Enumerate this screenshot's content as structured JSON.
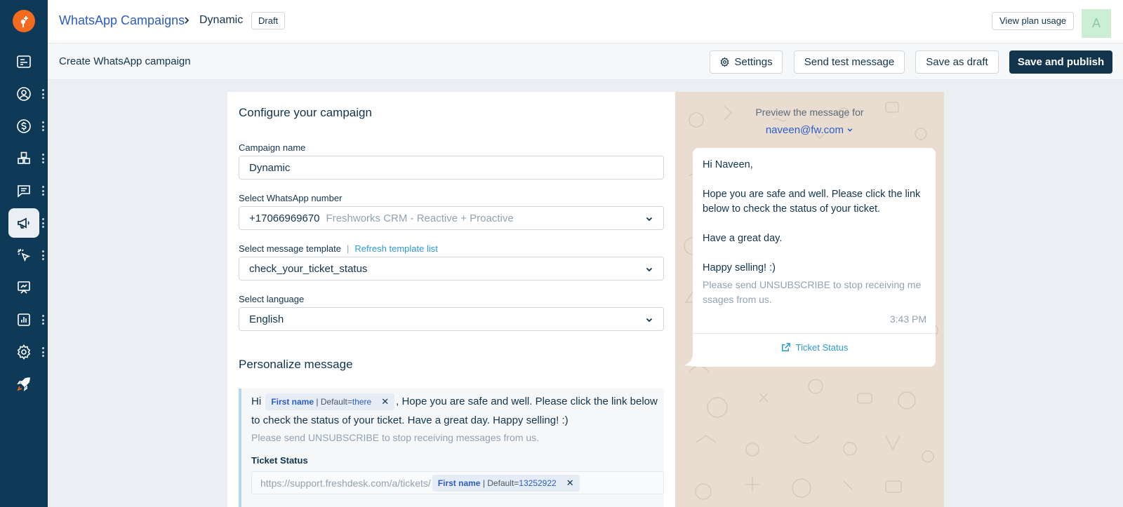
{
  "header": {
    "breadcrumb_link": "WhatsApp Campaigns",
    "breadcrumb_current": "Dynamic",
    "status_badge": "Draft",
    "plan_usage_button": "View plan usage",
    "avatar_initial": "A"
  },
  "sidebar": {
    "items": [
      {
        "icon": "dashboard-icon"
      },
      {
        "icon": "contacts-icon",
        "has_menu": true
      },
      {
        "icon": "deals-dollar-icon",
        "has_menu": true
      },
      {
        "icon": "modules-grid-icon",
        "has_menu": true
      },
      {
        "icon": "conversations-chat-icon",
        "has_menu": true
      },
      {
        "icon": "campaigns-megaphone-icon",
        "has_menu": true,
        "active": true
      },
      {
        "icon": "automation-cursor-icon",
        "has_menu": true
      },
      {
        "icon": "display-board-icon"
      },
      {
        "icon": "reports-chart-icon",
        "has_menu": true
      },
      {
        "icon": "settings-gear-icon",
        "has_menu": true
      },
      {
        "icon": "rocket-icon"
      }
    ]
  },
  "toolbar": {
    "title": "Create WhatsApp campaign",
    "settings": "Settings",
    "send_test": "Send test message",
    "save_draft": "Save as draft",
    "save_publish": "Save and publish"
  },
  "form": {
    "section_title": "Configure your campaign",
    "campaign_name_label": "Campaign name",
    "campaign_name_value": "Dynamic",
    "whatsapp_number_label": "Select WhatsApp number",
    "whatsapp_number_value": "+17066969670",
    "whatsapp_number_account": "Freshworks CRM - Reactive + Proactive",
    "template_label": "Select message template",
    "template_separator": "|",
    "refresh_link": "Refresh template list",
    "template_value": "check_your_ticket_status",
    "language_label": "Select language",
    "language_value": "English"
  },
  "personalize": {
    "title": "Personalize message",
    "greeting": "Hi",
    "chip1_field": "First name",
    "chip1_default_label": "| Default=",
    "chip1_default_value": "there",
    "chip_remove": "✕",
    "line1_rest": ", Hope you are safe and well. Please click the link below",
    "line2": "to check the status of your ticket. Have a great day. Happy selling! :)",
    "unsubscribe": "Please send UNSUBSCRIBE to stop receiving messages from us.",
    "button_label": "Ticket Status",
    "url_prefix": "https://support.freshdesk.com/a/tickets/",
    "chip2_field": "First name",
    "chip2_default_label": "| Default=",
    "chip2_default_value": "13252922"
  },
  "preview": {
    "label": "Preview the message for",
    "email": "naveen@fw.com",
    "greeting": "Hi Naveen,",
    "body_line1": "Hope you are safe and well. Please click the link",
    "body_line2": "below to check the status of your ticket.",
    "body_line3": "Have a great day.",
    "body_line4": "Happy selling! :)",
    "unsubscribe": "Please send UNSUBSCRIBE to stop receiving me ssages from us.",
    "time": "3:43 PM",
    "button": "Ticket Status"
  },
  "colors": {
    "sidebar": "#0f3a57",
    "brand_orange": "#f56b1e",
    "primary_button": "#12344d",
    "link_blue": "#2c5cc5",
    "preview_bg": "#e8ddd0"
  }
}
